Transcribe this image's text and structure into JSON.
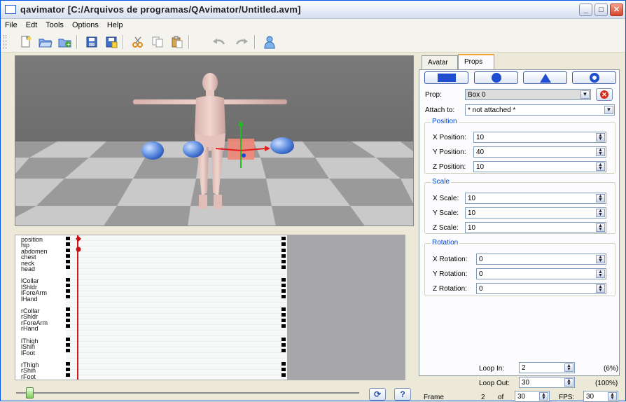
{
  "window": {
    "title": "qavimator [C:/Arquivos de programas/QAvimator/Untitled.avm]",
    "minimize": "_",
    "maximize": "□",
    "close": "✕"
  },
  "menu": [
    "File",
    "Edt",
    "Tools",
    "Options",
    "Help"
  ],
  "toolbar": {
    "icons": [
      "new-file-icon",
      "open-folder-icon",
      "add-file-icon",
      "save-icon",
      "save-as-icon",
      "cut-icon",
      "copy-icon",
      "paste-icon",
      "undo-icon",
      "redo-icon",
      "user-icon"
    ]
  },
  "timeline": {
    "groups": [
      [
        "position",
        "hip",
        "abdomen",
        "chest",
        "neck",
        "head"
      ],
      [
        "lCollar",
        "lShldr",
        "lForeArm",
        "lHand"
      ],
      [
        "rCollar",
        "rShldr",
        "rForeArm",
        "rHand"
      ],
      [
        "lThigh",
        "lShin",
        "lFoot"
      ],
      [
        "rThigh",
        "rShin",
        "rFoot"
      ]
    ]
  },
  "tabs": [
    "Avatar",
    "Props"
  ],
  "props": {
    "prop_label": "Prop:",
    "prop_value": "Box 0",
    "attach_label": "Attach to:",
    "attach_value": "* not attached *",
    "position_title": "Position",
    "x_pos_label": "X Position:",
    "x_pos": "10",
    "y_pos_label": "Y Position:",
    "y_pos": "40",
    "z_pos_label": "Z Position:",
    "z_pos": "10",
    "scale_title": "Scale",
    "x_scale_label": "X Scale:",
    "x_scale": "10",
    "y_scale_label": "Y Scale:",
    "y_scale": "10",
    "z_scale_label": "Z Scale:",
    "z_scale": "10",
    "rotation_title": "Rotation",
    "x_rot_label": "X Rotation:",
    "x_rot": "0",
    "y_rot_label": "Y Rotation:",
    "y_rot": "0",
    "z_rot_label": "Z Rotation:",
    "z_rot": "0"
  },
  "playback": {
    "loop_in_label": "Loop In:",
    "loop_in": "2",
    "loop_in_pct": "(6%)",
    "loop_out_label": "Loop Out:",
    "loop_out": "30",
    "loop_out_pct": "(100%)",
    "frame_label": "Frame",
    "frame": "2",
    "of_label": "of",
    "frame_total": "30",
    "fps_label": "FPS:",
    "fps": "30",
    "loop_button": "⟳",
    "help_button": "?"
  }
}
